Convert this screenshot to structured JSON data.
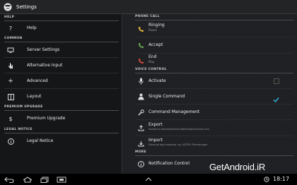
{
  "app": {
    "title": "Settings"
  },
  "left": {
    "sections": {
      "help": "HELP",
      "common": "COMMON",
      "premium": "PREMIUM UPGRADE",
      "legal": "LEGAL NOTICE"
    },
    "items": {
      "help": "Help",
      "server_settings": "Server Settings",
      "alternative_input": "Alternative Input",
      "advanced": "Advanced",
      "layout": "Layout",
      "premium_upgrade": "Premium Upgrade",
      "legal_notice": "Legal Notice"
    }
  },
  "right": {
    "sections": {
      "phone_call": "PHONE CALL",
      "voice_control": "VOICE CONTROL",
      "more": "MORE"
    },
    "items": {
      "ringing": {
        "label": "Ringing",
        "sub": "Pause"
      },
      "accept": {
        "label": "Accept"
      },
      "end": {
        "label": "End",
        "sub": "Play"
      },
      "activate": {
        "label": "Activate",
        "checked": false
      },
      "single_command": {
        "label": "Single Command",
        "checked": true
      },
      "command_management": {
        "label": "Command Management"
      },
      "export": {
        "label": "Export",
        "sub": "Saved to /sdcard/ibxsvrmobile/export/voice.xml"
      },
      "import": {
        "label": "Import",
        "sub": "External app required, eg. ASTRO Filemanager"
      },
      "notification_control": {
        "label": "Notification Control"
      }
    }
  },
  "status": {
    "time": "18:17"
  },
  "watermark": "GetAndroid.iR",
  "colors": {
    "accent_green": "#6aa84f",
    "ringing_yellow": "#e0b43c",
    "end_red": "#d44a3a",
    "check_blue": "#33b5e5"
  },
  "icons": {
    "app": "face-icon",
    "back": "back-icon",
    "home": "home-icon",
    "recents": "recents-icon",
    "screenshot": "screenshot-icon",
    "menu": "up-chevron-icon"
  }
}
